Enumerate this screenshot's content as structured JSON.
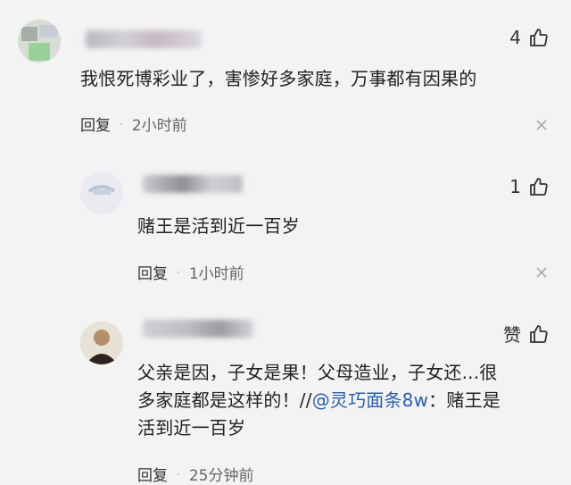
{
  "comments": [
    {
      "likes": "4",
      "text": "我恨死博彩业了，害惨好多家庭，万事都有因果的",
      "reply_label": "回复",
      "separator": "·",
      "time": "2小时前"
    },
    {
      "likes": "1",
      "text": "赌王是活到近一百岁",
      "reply_label": "回复",
      "separator": "·",
      "time": "1小时前"
    },
    {
      "likes": "赞",
      "text_line1": "父亲是因，子女是果！父母造业，子女还...很",
      "text_line2_pre": "多家庭都是这样的！//",
      "mention": "@灵巧面条8w",
      "text_line2_post": "：赌王是",
      "text_line3": "活到近一百岁",
      "reply_label": "回复",
      "separator": "·",
      "time": "25分钟前"
    }
  ]
}
